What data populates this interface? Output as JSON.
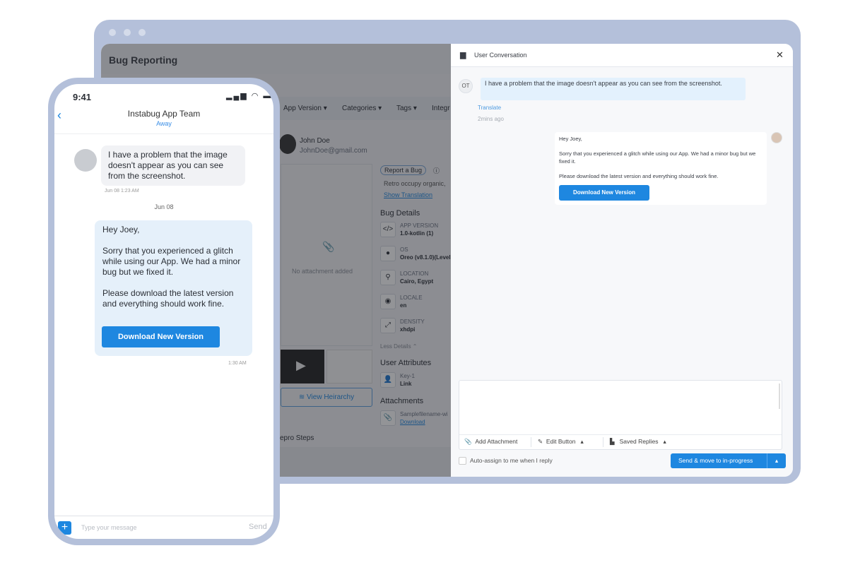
{
  "desktop": {
    "app": {
      "title": "Bug Reporting",
      "filters": [
        "App Version",
        "Categories",
        "Tags",
        "Integr"
      ],
      "user": {
        "name": "John Doe",
        "email": "JohnDoe@gmail.com"
      },
      "attachment_placeholder": "No attachment added",
      "report_badge": "Report a Bug",
      "description": "Retro occupy organic,",
      "show_translation": "Show Translation",
      "bug_details_title": "Bug Details",
      "bug_details": [
        {
          "label": "APP VERSION",
          "value": "1.0-kotlin (1)",
          "icon": "code-icon"
        },
        {
          "label": "OS",
          "value": "Oreo (v8.1.0)(Level",
          "icon": "android-icon"
        },
        {
          "label": "LOCATION",
          "value": "Cairo, Egypt",
          "icon": "location-pin-icon"
        },
        {
          "label": "LOCALE",
          "value": "en",
          "icon": "globe-icon"
        },
        {
          "label": "DENSITY",
          "value": "xhdpi",
          "icon": "expand-icon"
        }
      ],
      "less_details": "Less Details",
      "view_hierarchy": "View Heirarchy",
      "user_attributes_title": "User Attributes",
      "user_attribute": {
        "key": "Key-1",
        "value": "Link"
      },
      "attachments_title": "Attachments",
      "attachment": {
        "name": "Samplefilename-wi",
        "action": "Download"
      },
      "repro_steps_title": "epro Steps"
    },
    "conversation": {
      "title": "User Conversation",
      "user_initials": "OT",
      "user_message": "I have a problem that the image doesn't appear as you can see from the screenshot.",
      "translate": "Translate",
      "time": "2mins ago",
      "reply": {
        "greeting": "Hey Joey,",
        "body": "Sorry that you experienced a glitch while using our App. We had a minor bug but we fixed it.",
        "closing": "Please download the latest version and everything should work fine.",
        "button": "Download New Version"
      },
      "composer": {
        "add_attachment": "Add Attachment",
        "edit_button": "Edit Button",
        "saved_replies": "Saved Replies"
      },
      "auto_assign": "Auto-assign to me when I reply",
      "auto_assign_checked": false,
      "send_button": "Send & move to in-progress"
    }
  },
  "phone": {
    "time": "9:41",
    "team": "Instabug App Team",
    "status": "Away",
    "user_message": "I have a problem that the image doesn't appear as you can see from the screenshot.",
    "user_message_time": "Jun 08 1:23 AM",
    "date_divider": "Jun 08",
    "reply": {
      "greeting": "Hey Joey,",
      "body": "Sorry that you experienced a glitch while using our App. We had a minor bug but we fixed it.",
      "closing": "Please download the latest version and everything should work fine.",
      "button": "Download New Version",
      "time": "1:30 AM"
    },
    "input_placeholder": "Type your message",
    "send": "Send"
  },
  "colors": {
    "accent": "#1e87e0",
    "frame": "#b4c0da",
    "user_bubble": "#e3f1fd"
  }
}
